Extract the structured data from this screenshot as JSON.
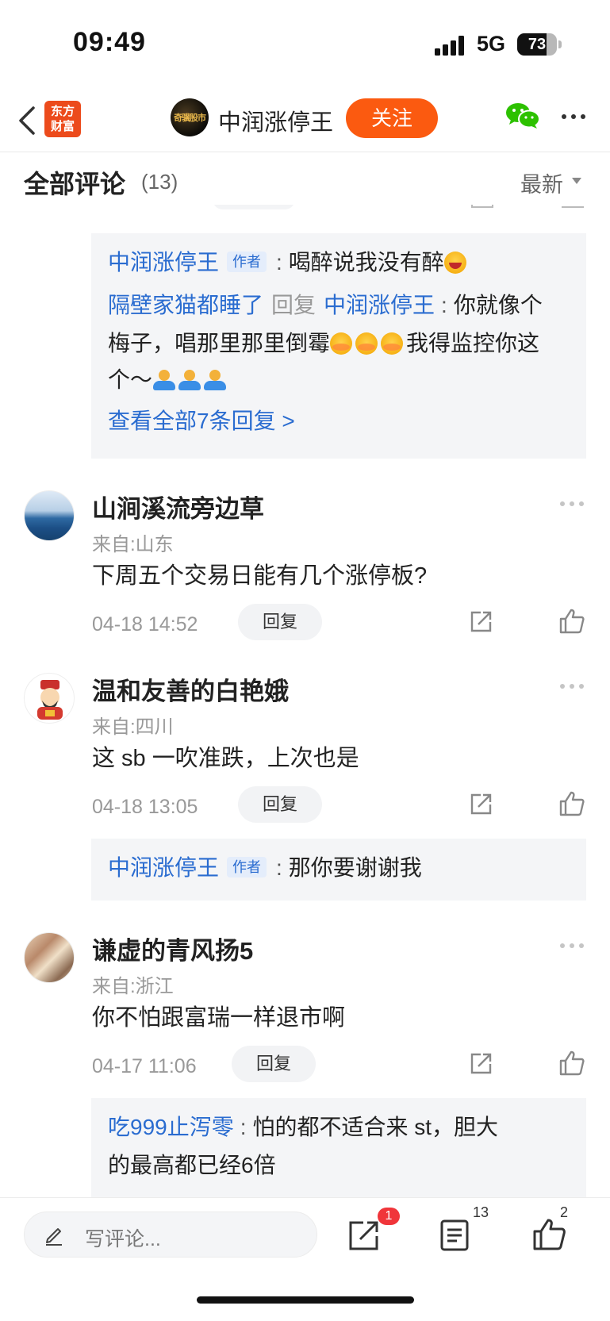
{
  "status_bar": {
    "time": "09:49",
    "network": "5G",
    "battery": "73",
    "battery_level": 0.73
  },
  "nav": {
    "app_logo_line1": "东方",
    "app_logo_line2": "财富",
    "author_avatar_text": "奇骥股市",
    "author_name": "中润涨停王",
    "follow_label": "关注"
  },
  "comments_header": {
    "title": "全部评论",
    "count": "(13)",
    "sort_label": "最新"
  },
  "reply_box_1": {
    "line1": {
      "user": "中润涨停王",
      "tag": "作者",
      "colon": ":",
      "text": "喝醉说我没有醉"
    },
    "line2": {
      "user": "隔壁家猫都睡了",
      "reply_word": "回复",
      "target": "中润涨停王",
      "colon": ":",
      "text_a": "你就像个"
    },
    "line3": "梅子，唱那里那里倒霉",
    "line3_tail": "我得监控你这",
    "line4": "个～",
    "view_all": "查看全部7条回复 >"
  },
  "comments": [
    {
      "name": "山涧溪流旁边草",
      "location": "来自:山东",
      "text": "下周五个交易日能有几个涨停板?",
      "time": "04-18 14:52",
      "reply_label": "回复"
    },
    {
      "name": "温和友善的白艳娥",
      "location": "来自:四川",
      "text": "这 sb 一吹准跌，上次也是",
      "time": "04-18 13:05",
      "reply_label": "回复"
    },
    {
      "name": "谦虚的青风扬5",
      "location": "来自:浙江",
      "text": "你不怕跟富瑞一样退市啊",
      "time": "04-17 11:06",
      "reply_label": "回复"
    }
  ],
  "reply_box_2": {
    "user": "中润涨停王",
    "tag": "作者",
    "colon": ":",
    "text": "那你要谢谢我"
  },
  "reply_box_3": {
    "user": "吃999止泻零",
    "colon": ":",
    "line1": "怕的都不适合来 st，胆大",
    "line2": "的最高都已经6倍"
  },
  "bottom_bar": {
    "input_placeholder": "写评论...",
    "share_badge": "1",
    "comments_count": "13",
    "likes_count": "2"
  },
  "icons": [
    "back-icon",
    "wechat-icon",
    "more-icon",
    "share-icon",
    "like-icon",
    "pencil-icon",
    "comment-list-icon"
  ],
  "colors": {
    "accent": "#fb5a10",
    "link": "#2a6cd0",
    "badge": "#f0353a"
  }
}
